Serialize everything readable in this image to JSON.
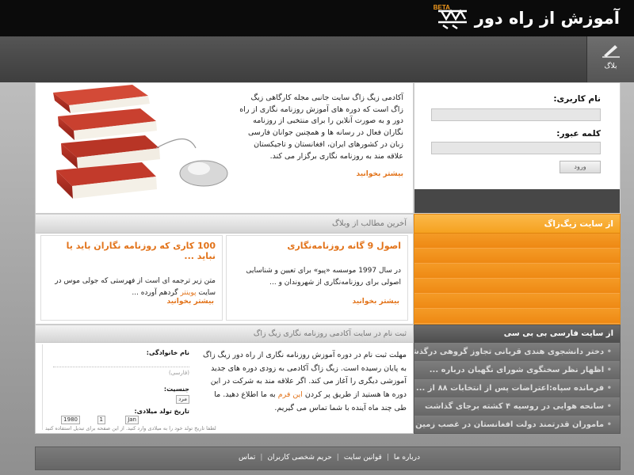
{
  "brand": {
    "title": "آموزش از راه دور",
    "beta": "BETA"
  },
  "nav": {
    "blog_label": "بلاگ"
  },
  "intro": {
    "text": "آکادمی زیگ زاگ سایت جانبی مجله کارگاهی زیگ زاگ است که دوره های آموزش روزنامه نگاری از راه دور و به صورت آنلاین را برای منتخبی از روزنامه نگاران فعال در رسانه ها و همچنین جوانان فارسی زبان در کشورهای ایران، افغانستان و تاجیکستان علاقه مند به روزنامه نگاری برگزار می کند.",
    "more": "بیشتر بخوانید"
  },
  "login": {
    "username_label": "نام کاربری:",
    "password_label": "کلمه عبور:",
    "submit_label": "ورود"
  },
  "recent": {
    "heading": "آخرین مطالب از وبلاگ",
    "posts": [
      {
        "title": "اصول 9 گانه روزنامه‌نگاری",
        "body": "در سال 1997 موسسه «پیو» برای تعیین و شناسایی اصولی برای روزنامه‌نگاری از شهروندان و ...",
        "more": "بیشتر بخوانید"
      },
      {
        "title": "100 کاری که روزنامه نگاران باید یا نباید ...",
        "body_pre": "متن زیر ترجمه ای است از فهرستی که جولی موس در سایت ",
        "body_link": "پوینتر",
        "body_post": " گردهم آورده ...",
        "more": "بیشتر بخوانید"
      }
    ]
  },
  "zigzag": {
    "heading": "از سایت زیگ‌زاگ"
  },
  "register": {
    "heading": "ثبت نام در سایت آکادمی روزنامه نگاری زیگ زاگ",
    "text_pre": "مهلت ثبت نام در دوره آموزش روزنامه نگاری از راه دور زیگ زاگ به پایان رسیده است. زیگ زاگ آکادمی به زودی دوره های جدید آموزشی دیگری را آغاز می کند. اگر علاقه مند به شرکت در این دوره ها هستید از طریق پر کردن ",
    "text_link": "این فرم",
    "text_post": " به ما اطلاع دهید. ما طی چند ماه آینده با شما تماس می گیریم.",
    "form": {
      "name_label": "نام خانوادگی:",
      "name_hint": "(فارسی)",
      "gender_label": "جنسیت:",
      "gender_value": "مرد",
      "dob_label": "تاریخ تولد میلادی:",
      "dob_year": "1980",
      "dob_day": "1",
      "dob_month": "Jan",
      "note": "لطفا تاریخ تولد خود را به میلادی وارد کنید. از این صفحه برای تبدیل استفاده کنید"
    }
  },
  "bbc": {
    "heading": "از سایت فارسی بی بی سی",
    "items": [
      "دختر دانشجوی هندی قربانی تجاوز گروهی درگذشت",
      "اظهار نظر سخنگوی شورای نگهبان درباره ...",
      "فرمانده سپاه:اعتراضات پس از انتخابات ۸۸ از ...",
      "سانحه هوایی در روسیه ۴ کشته برجای گذاشت",
      "ماموران قدرتمند دولت افغانستان در غصب زمین ..."
    ]
  },
  "footer": {
    "links": [
      "درباره ما",
      "قوانین سایت",
      "حریم شخصی کاربران",
      "تماس"
    ],
    "separator": "|"
  },
  "colors": {
    "accent": "#e2731a",
    "orange_panel": "#f08c1a",
    "dark": "#0b0b0b"
  },
  "icons": {
    "blog": "pen-icon",
    "logo": "zigzag-logo-icon"
  }
}
